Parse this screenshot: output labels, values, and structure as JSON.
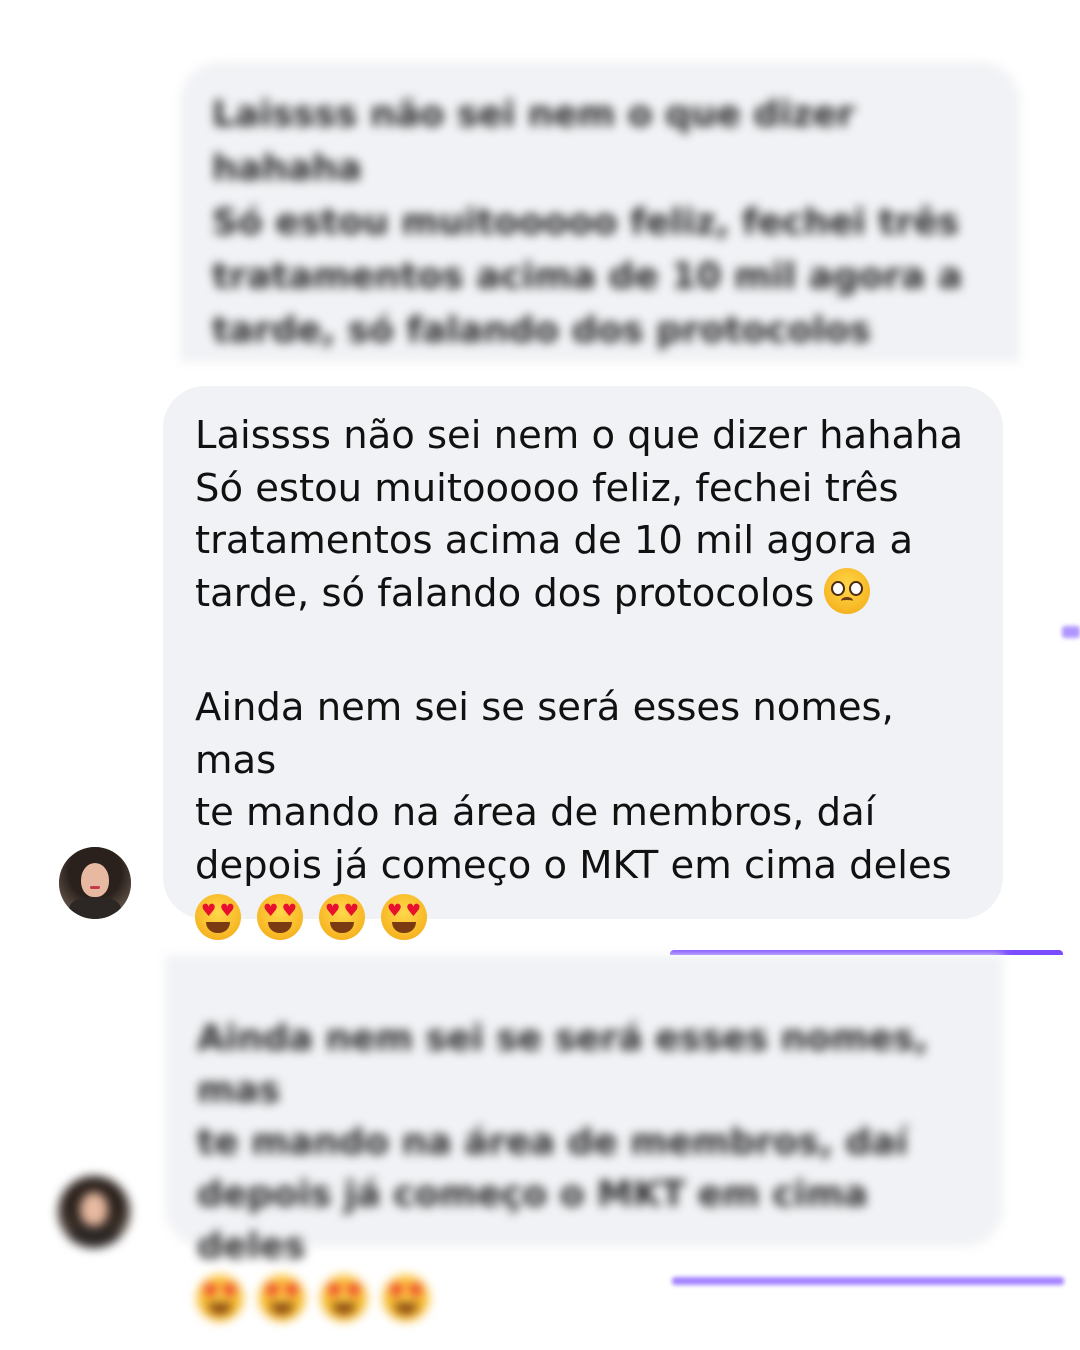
{
  "messages": {
    "blurred_top": {
      "text": "Laissss não sei nem o que dizer hahaha\nSó estou muitooooo feliz, fechei três\ntratamentos acima de 10 mil agora a\ntarde, só falando dos protocolos"
    },
    "main": {
      "paragraph_1": "Laissss não sei nem o que dizer hahaha\nSó estou muitooooo feliz, fechei três\ntratamentos acima de 10 mil agora a\ntarde, só falando dos protocolos",
      "paragraph_1_emoji": "pleading-face-icon",
      "paragraph_2": "Ainda nem sei se será esses nomes, mas\nte mando na área de membros, daí\ndepois já começo o MKT em cima deles",
      "emoji_row": [
        "heart-eyes-icon",
        "heart-eyes-icon",
        "heart-eyes-icon",
        "heart-eyes-icon"
      ]
    },
    "blurred_bottom": {
      "text": "Ainda nem sei se será esses nomes, mas\nte mando na área de membros, daí\ndepois já começo o MKT em cima deles"
    }
  },
  "colors": {
    "bubble": "#f1f2f5",
    "accent": "#7c4dff"
  }
}
